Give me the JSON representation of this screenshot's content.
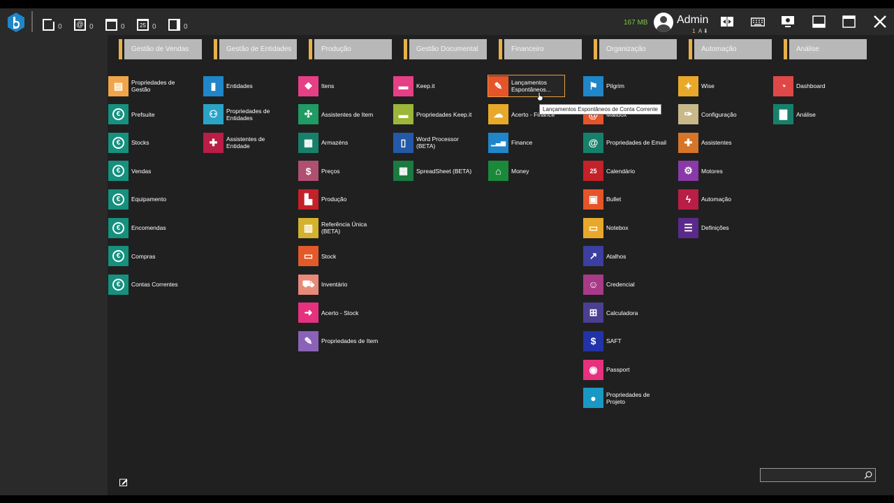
{
  "topbar": {
    "counters": [
      {
        "name": "tasks-counter",
        "icon": "task-icon",
        "symbol": "",
        "value": "0"
      },
      {
        "name": "mail-counter",
        "icon": "mail-icon",
        "symbol": "@",
        "value": "0"
      },
      {
        "name": "notes-counter",
        "icon": "note-icon",
        "symbol": "",
        "value": "0"
      },
      {
        "name": "calendar-counter",
        "icon": "calendar-icon",
        "symbol": "25",
        "value": "0"
      },
      {
        "name": "bullet-counter",
        "icon": "bullet-icon",
        "symbol": "",
        "value": "0"
      }
    ],
    "memory": "167 MB",
    "user_name": "Admin",
    "user_number": "1",
    "user_letter": "A"
  },
  "columns": [
    {
      "title": "Gestão de Vendas",
      "items": [
        {
          "label": "Propriedades de Gestão",
          "icon": "document-properties-icon",
          "color": "#f0a54a"
        },
        {
          "label": "Prefsuite",
          "icon": "euro-icon",
          "color": "#15917e"
        },
        {
          "label": "Stocks",
          "icon": "euro-icon",
          "color": "#15917e"
        },
        {
          "label": "Vendas",
          "icon": "euro-icon",
          "color": "#15917e"
        },
        {
          "label": "Equipamento",
          "icon": "euro-icon",
          "color": "#15917e"
        },
        {
          "label": "Encomendas",
          "icon": "euro-icon",
          "color": "#15917e"
        },
        {
          "label": "Compras",
          "icon": "euro-icon",
          "color": "#15917e"
        },
        {
          "label": "Contas Correntes",
          "icon": "euro-icon",
          "color": "#15917e"
        }
      ]
    },
    {
      "title": "Gestão de Entidades",
      "items": [
        {
          "label": "Entidades",
          "icon": "person-icon",
          "color": "#1f86c9"
        },
        {
          "label": "Propriedades de Entidades",
          "icon": "people-properties-icon",
          "color": "#2aa3c7"
        },
        {
          "label": "Assistentes de Entidade",
          "icon": "entity-wizard-icon",
          "color": "#b81e46"
        }
      ]
    },
    {
      "title": "Produção",
      "items": [
        {
          "label": "Itens",
          "icon": "diamond-icon",
          "color": "#e63f86"
        },
        {
          "label": "Assistentes de Item",
          "icon": "item-wizard-icon",
          "color": "#1f9b63"
        },
        {
          "label": "Armazéns",
          "icon": "warehouse-icon",
          "color": "#17806b"
        },
        {
          "label": "Preços",
          "icon": "price-tag-icon",
          "color": "#b05070"
        },
        {
          "label": "Produção",
          "icon": "factory-icon",
          "color": "#c42128"
        },
        {
          "label": "Referência Única (BETA)",
          "icon": "barcode-icon",
          "color": "#d4b22e"
        },
        {
          "label": "Stock",
          "icon": "stock-icon",
          "color": "#e25a2a"
        },
        {
          "label": "Inventário",
          "icon": "truck-icon",
          "color": "#e88a7a"
        },
        {
          "label": "Acerto - Stock",
          "icon": "stock-adjust-icon",
          "color": "#e6317e"
        },
        {
          "label": "Propriedades de Item",
          "icon": "item-properties-icon",
          "color": "#8a63b8"
        }
      ]
    },
    {
      "title": "Gestão Documental",
      "items": [
        {
          "label": "Keep.it",
          "icon": "archive-icon",
          "color": "#e63f86"
        },
        {
          "label": "Propriedades Keep.it",
          "icon": "archive-properties-icon",
          "color": "#9bb638"
        },
        {
          "label": "Word Processor (BETA)",
          "icon": "book-icon",
          "color": "#2459a8"
        },
        {
          "label": "SpreadSheet (BETA)",
          "icon": "spreadsheet-icon",
          "color": "#1a7a40"
        }
      ]
    },
    {
      "title": "Financeiro",
      "items": [
        {
          "label": "Lançamentos Espontâneos...",
          "icon": "ledger-icon",
          "color": "#e6542a"
        },
        {
          "label": "Acerto - Finance",
          "icon": "finance-adjust-icon",
          "color": "#e8a92a"
        },
        {
          "label": "Finance",
          "icon": "bar-chart-icon",
          "color": "#1f86c9"
        },
        {
          "label": "Money",
          "icon": "bank-icon",
          "color": "#1a8a3a"
        }
      ]
    },
    {
      "title": "Organização",
      "items": [
        {
          "label": "Pilgrim",
          "icon": "pilgrim-icon",
          "color": "#1f86c9"
        },
        {
          "label": "Mailbox",
          "icon": "mail-icon",
          "color": "#e6542a"
        },
        {
          "label": "Propriedades de Email",
          "icon": "email-properties-icon",
          "color": "#17806b"
        },
        {
          "label": "Calendário",
          "icon": "calendar-icon",
          "color": "#c42128"
        },
        {
          "label": "Bullet",
          "icon": "bullet-icon",
          "color": "#e6542a"
        },
        {
          "label": "Notebox",
          "icon": "note-icon",
          "color": "#e8a92a"
        },
        {
          "label": "Atalhos",
          "icon": "shortcut-icon",
          "color": "#3b3fa0"
        },
        {
          "label": "Credencial",
          "icon": "credential-icon",
          "color": "#a83a88"
        },
        {
          "label": "Calculadora",
          "icon": "calculator-icon",
          "color": "#4a3f90"
        },
        {
          "label": "SAFT",
          "icon": "saft-icon",
          "color": "#2233a8"
        },
        {
          "label": "Passport",
          "icon": "passport-icon",
          "color": "#e6317e"
        },
        {
          "label": "Propriedades de Projeto",
          "icon": "project-properties-icon",
          "color": "#1a98c4"
        }
      ]
    },
    {
      "title": "Automação",
      "items": [
        {
          "label": "Wise",
          "icon": "wand-icon",
          "color": "#e8a92a"
        },
        {
          "label": "Configuração",
          "icon": "wrench-icon",
          "color": "#c8b88a"
        },
        {
          "label": "Assistentes",
          "icon": "puzzle-icon",
          "color": "#d4752a"
        },
        {
          "label": "Motores",
          "icon": "engine-icon",
          "color": "#8a3aa8"
        },
        {
          "label": "Automação",
          "icon": "lightning-icon",
          "color": "#b81e46"
        },
        {
          "label": "Definições",
          "icon": "sliders-icon",
          "color": "#5a2a8a"
        }
      ]
    },
    {
      "title": "Análise",
      "items": [
        {
          "label": "Dashboard",
          "icon": "gauge-icon",
          "color": "#e04848"
        },
        {
          "label": "Análise",
          "icon": "analysis-chart-icon",
          "color": "#17806b"
        }
      ]
    }
  ],
  "tooltip": "Lançamentos Espontâneos de Conta Corrente",
  "search": {
    "placeholder": "",
    "value": ""
  }
}
